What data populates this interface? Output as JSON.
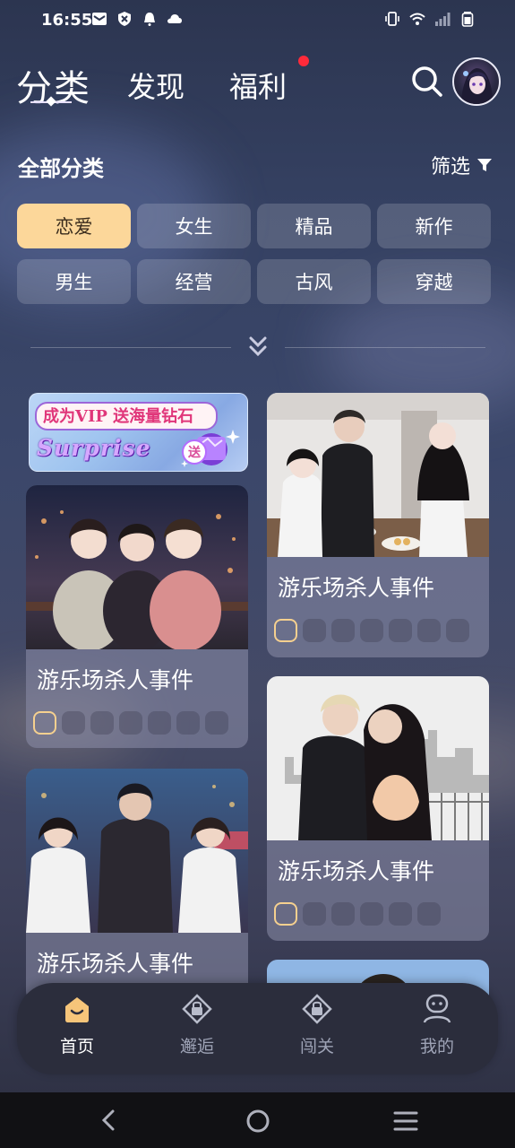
{
  "status_bar": {
    "time": "16:55"
  },
  "header": {
    "tabs": [
      {
        "label": "分类"
      },
      {
        "label": "发现"
      },
      {
        "label": "福利"
      }
    ]
  },
  "category_section": {
    "title": "全部分类",
    "filter_label": "筛选",
    "categories": [
      {
        "label": "恋爱",
        "active": true
      },
      {
        "label": "女生"
      },
      {
        "label": "精品"
      },
      {
        "label": "新作"
      },
      {
        "label": "男生"
      },
      {
        "label": "经营"
      },
      {
        "label": "古风"
      },
      {
        "label": "穿越"
      }
    ]
  },
  "banner": {
    "text": "成为VIP 送海量钻石",
    "subtitle": "Surprise",
    "badge": "送"
  },
  "cards": [
    {
      "title": "游乐场杀人事件"
    },
    {
      "title": "游乐场杀人事件"
    },
    {
      "title": "游乐场杀人事件"
    },
    {
      "title": "游乐场杀人事件"
    }
  ],
  "bottom_nav": [
    {
      "label": "首页",
      "active": true
    },
    {
      "label": "邂逅"
    },
    {
      "label": "闯关"
    },
    {
      "label": "我的"
    }
  ]
}
